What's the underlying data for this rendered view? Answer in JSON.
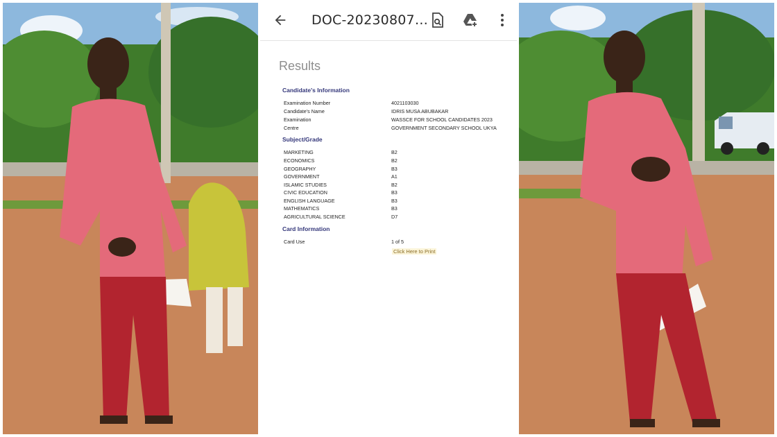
{
  "appbar": {
    "title": "DOC-20230807…",
    "icons": [
      "back-arrow-icon",
      "search-document-icon",
      "drive-add-icon",
      "more-vert-icon"
    ]
  },
  "document": {
    "heading": "Results",
    "candidate_section": "Candidate's Information",
    "candidate_rows": [
      {
        "label": "Examination Number",
        "value": "4021103030"
      },
      {
        "label": "Candidate's Name",
        "value": "IDRIS MUSA ABUBAKAR"
      },
      {
        "label": "Examination",
        "value": "WASSCE FOR SCHOOL CANDIDATES 2023"
      },
      {
        "label": "Centre",
        "value": "GOVERNMENT SECONDARY SCHOOL UKYA"
      }
    ],
    "subject_section": "Subject/Grade",
    "subjects": [
      {
        "subject": "MARKETING",
        "grade": "B2"
      },
      {
        "subject": "ECONOMICS",
        "grade": "B2"
      },
      {
        "subject": "GEOGRAPHY",
        "grade": "B3"
      },
      {
        "subject": "GOVERNMENT",
        "grade": "A1"
      },
      {
        "subject": "ISLAMIC STUDIES",
        "grade": "B2"
      },
      {
        "subject": "CIVIC EDUCATION",
        "grade": "B3"
      },
      {
        "subject": "ENGLISH LANGUAGE",
        "grade": "B3"
      },
      {
        "subject": "MATHEMATICS",
        "grade": "B3"
      },
      {
        "subject": "AGRICULTURAL SCIENCE",
        "grade": "D7"
      }
    ],
    "card_section": "Card Information",
    "card_rows": [
      {
        "label": "Card Use",
        "value": "1 of 5"
      }
    ],
    "print_link": "Click Here to Print"
  },
  "colors": {
    "section_heading": "#34377a",
    "results_heading": "#8d8d8d",
    "shirt": "#e46a7a",
    "trousers": "#b2242f",
    "ground": "#c8865a",
    "foliage": "#3f7b2b",
    "sky": "#8db8dd"
  }
}
